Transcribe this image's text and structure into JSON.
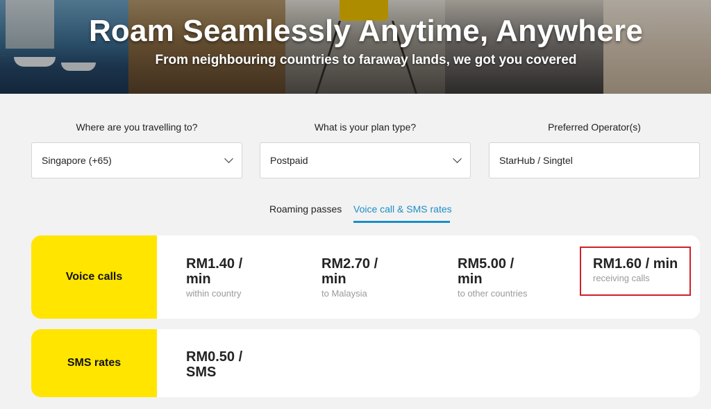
{
  "hero": {
    "title": "Roam Seamlessly Anytime, Anywhere",
    "subtitle": "From neighbouring countries to faraway lands, we got you covered"
  },
  "filters": [
    {
      "label": "Where are you travelling to?",
      "value": "Singapore (+65)",
      "has_dropdown": true
    },
    {
      "label": "What is your plan type?",
      "value": "Postpaid",
      "has_dropdown": true
    },
    {
      "label": "Preferred Operator(s)",
      "value": "StarHub / Singtel",
      "has_dropdown": false
    }
  ],
  "tabs": [
    {
      "label": "Roaming passes",
      "active": false
    },
    {
      "label": "Voice call & SMS rates",
      "active": true
    }
  ],
  "voice": {
    "title": "Voice calls",
    "rates": [
      {
        "value_line1": "RM1.40 /",
        "value_line2": "min",
        "sub": "within country"
      },
      {
        "value_line1": "RM2.70 /",
        "value_line2": "min",
        "sub": "to Malaysia"
      },
      {
        "value_line1": "RM5.00 /",
        "value_line2": "min",
        "sub": "to other countries"
      },
      {
        "value_line1": "RM1.60 / min",
        "value_line2": "",
        "sub": "receiving calls"
      }
    ]
  },
  "sms": {
    "title": "SMS rates",
    "rates": [
      {
        "value_line1": "RM0.50 /",
        "value_line2": "SMS"
      }
    ]
  },
  "colors": {
    "accent_yellow": "#ffe500",
    "tab_blue": "#1a8ec7",
    "highlight_red": "#d0202a"
  }
}
